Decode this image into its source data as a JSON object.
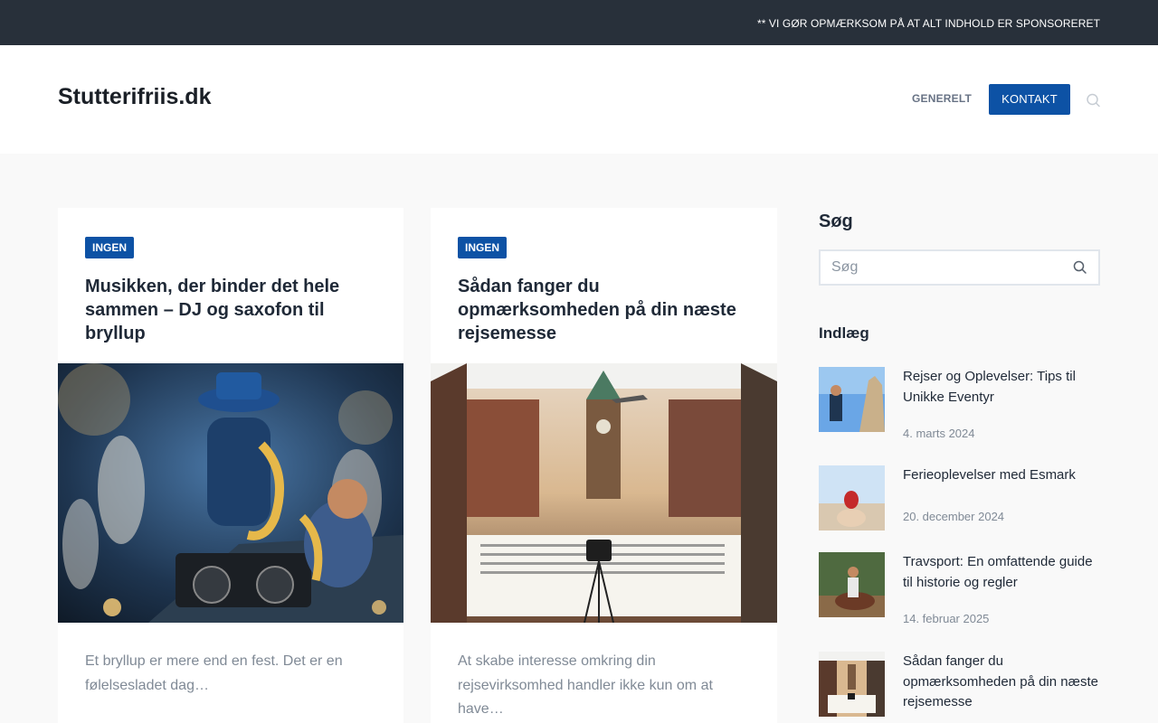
{
  "topbar": {
    "notice": "** VI GØR OPMÆRKSOM PÅ AT ALT INDHOLD ER SPONSORERET"
  },
  "header": {
    "site_title": "Stutterifriis.dk",
    "nav": [
      {
        "label": "GENERELT"
      },
      {
        "label": "KONTAKT"
      }
    ],
    "search_icon": "search-icon"
  },
  "articles": [
    {
      "category": "INGEN",
      "title": "Musikken, der binder det hele sammen – DJ og saxofon til bryllup",
      "excerpt": "Et bryllup er mere end en fest. Det er en følelsesladet dag…"
    },
    {
      "category": "INGEN",
      "title": "Sådan fanger du opmærksomheden på din næste rejsemesse",
      "excerpt": "At skabe interesse omkring din rejsevirksomhed handler ikke kun om at have…"
    }
  ],
  "sidebar": {
    "search_title": "Søg",
    "search_placeholder": "Søg",
    "posts_title": "Indlæg",
    "posts": [
      {
        "title": "Rejser og Oplevelser: Tips til Unikke Eventyr",
        "date": "4. marts 2024"
      },
      {
        "title": "Ferieoplevelser med Esmark",
        "date": "20. december 2024"
      },
      {
        "title": "Travsport: En omfattende guide til historie og regler",
        "date": "14. februar 2025"
      },
      {
        "title": "Sådan fanger du opmærksomheden på din næste rejsemesse",
        "date": ""
      }
    ]
  },
  "colors": {
    "topbar_bg": "#28303a",
    "accent": "#0d52a5",
    "page_bg": "#f9f9f9",
    "card_bg": "#ffffff"
  }
}
